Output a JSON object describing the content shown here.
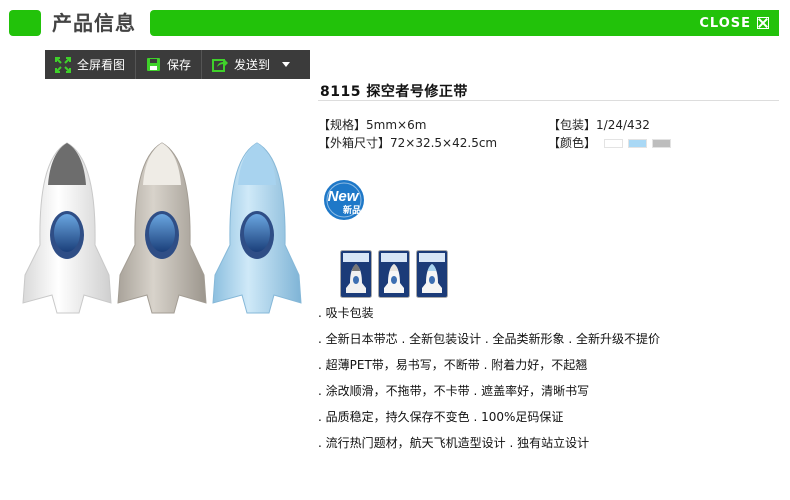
{
  "header": {
    "title": "产品信息",
    "close_label": "CLOSE",
    "accent_color": "#22c20a"
  },
  "toolbar": {
    "fullscreen_label": "全屏看图",
    "save_label": "保存",
    "send_label": "发送到"
  },
  "product": {
    "title": "8115 探空者号修正带",
    "specs": {
      "size_label": "【规格】",
      "size_value": "5mm×6m",
      "pack_label": "【包装】",
      "pack_value": "1/24/432",
      "carton_label": "【外箱尺寸】",
      "carton_value": "72×32.5×42.5cm",
      "color_label": "【颜色】",
      "colors": [
        "#ffffff",
        "#a9d8f5",
        "#bdbdbd"
      ]
    },
    "badge": {
      "text_en": "New",
      "text_cn": "新品"
    },
    "thumbnails": [
      "thumbnail-pack-1",
      "thumbnail-pack-2",
      "thumbnail-pack-3"
    ],
    "features": [
      ". 吸卡包装",
      ". 全新日本带芯 . 全新包装设计 . 全品类新形象 . 全新升级不提价",
      ". 超薄PET带，易书写，不断带 .  附着力好，不起翘",
      ". 涂改顺滑，不拖带，不卡带 .  遮盖率好，清晰书写",
      ". 品质稳定，持久保存不变色 .   100%足码保证",
      ". 流行热门题材，航天飞机造型设计 . 独有站立设计"
    ]
  }
}
